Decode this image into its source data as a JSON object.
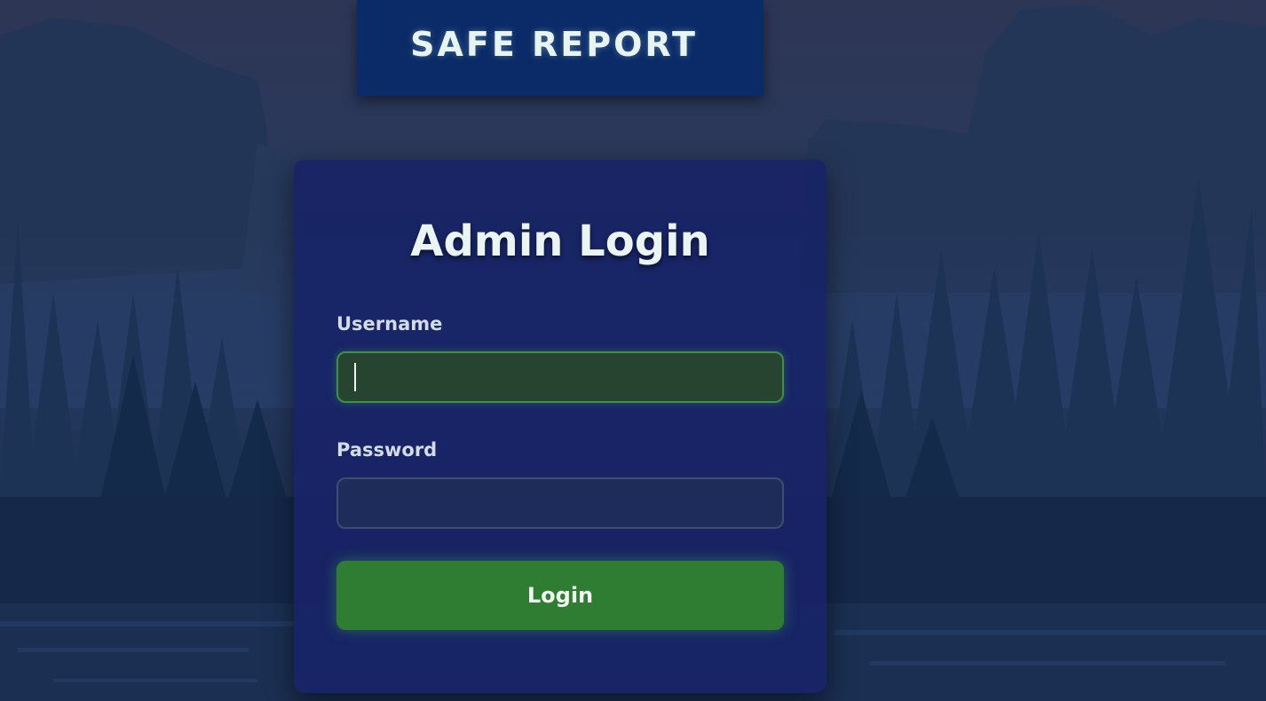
{
  "banner": {
    "title": "SAFE REPORT"
  },
  "login_card": {
    "title": "Admin Login",
    "username": {
      "label": "Username",
      "value": ""
    },
    "password": {
      "label": "Password",
      "value": ""
    },
    "submit_label": "Login"
  },
  "colors": {
    "banner_background": "#0b2a68",
    "card_background": "#18246a",
    "focused_input_background": "#26442f",
    "focused_input_border": "#3f8f45",
    "input_background": "#1d2c5a",
    "button_background": "#2e7d32",
    "title_text": "#eaf4f2"
  }
}
